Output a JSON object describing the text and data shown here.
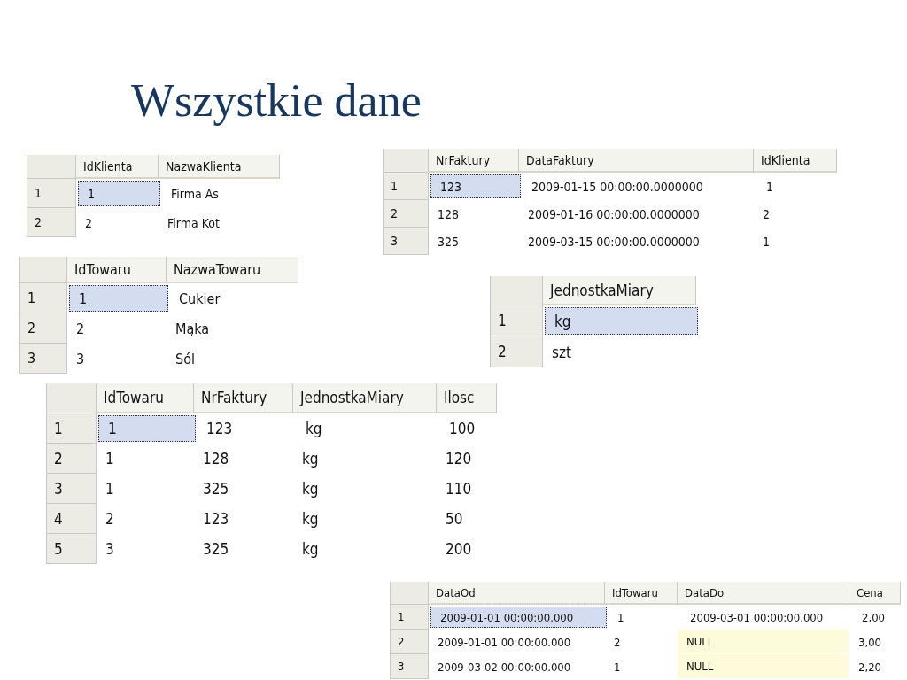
{
  "title": "Wszystkie dane",
  "tables": [
    {
      "columns": [
        "IdKlienta",
        "NazwaKlienta"
      ],
      "rows": [
        {
          "number": "1",
          "selected": true,
          "cells": [
            "1",
            "Firma As"
          ]
        },
        {
          "number": "2",
          "selected": false,
          "cells": [
            "2",
            "Firma Kot"
          ]
        }
      ]
    },
    {
      "columns": [
        "NrFaktury",
        "DataFaktury",
        "IdKlienta"
      ],
      "rows": [
        {
          "number": "1",
          "selected": true,
          "cells": [
            "123",
            "2009-01-15 00:00:00.0000000",
            "1"
          ]
        },
        {
          "number": "2",
          "selected": false,
          "cells": [
            "128",
            "2009-01-16 00:00:00.0000000",
            "2"
          ]
        },
        {
          "number": "3",
          "selected": false,
          "cells": [
            "325",
            "2009-03-15 00:00:00.0000000",
            "1"
          ]
        }
      ]
    },
    {
      "columns": [
        "IdTowaru",
        "NazwaTowaru"
      ],
      "rows": [
        {
          "number": "1",
          "selected": true,
          "cells": [
            "1",
            "Cukier"
          ]
        },
        {
          "number": "2",
          "selected": false,
          "cells": [
            "2",
            "Mąka"
          ]
        },
        {
          "number": "3",
          "selected": false,
          "cells": [
            "3",
            "Sól"
          ]
        }
      ]
    },
    {
      "columns": [
        "JednostkaMiary"
      ],
      "rows": [
        {
          "number": "1",
          "selected": true,
          "cells": [
            "kg"
          ]
        },
        {
          "number": "2",
          "selected": false,
          "cells": [
            "szt"
          ]
        }
      ]
    },
    {
      "columns": [
        "IdTowaru",
        "NrFaktury",
        "JednostkaMiary",
        "Ilosc"
      ],
      "rows": [
        {
          "number": "1",
          "selected": true,
          "cells": [
            "1",
            "123",
            "kg",
            "100"
          ]
        },
        {
          "number": "2",
          "selected": false,
          "cells": [
            "1",
            "128",
            "kg",
            "120"
          ]
        },
        {
          "number": "3",
          "selected": false,
          "cells": [
            "1",
            "325",
            "kg",
            "110"
          ]
        },
        {
          "number": "4",
          "selected": false,
          "cells": [
            "2",
            "123",
            "kg",
            "50"
          ]
        },
        {
          "number": "5",
          "selected": false,
          "cells": [
            "3",
            "325",
            "kg",
            "200"
          ]
        }
      ]
    },
    {
      "columns": [
        "DataOd",
        "IdTowaru",
        "DataDo",
        "Cena"
      ],
      "rows": [
        {
          "number": "1",
          "selected": true,
          "cells": [
            "2009-01-01 00:00:00.000",
            "1",
            "2009-03-01 00:00:00.000",
            "2,00"
          ]
        },
        {
          "number": "2",
          "selected": false,
          "cells": [
            "2009-01-01 00:00:00.000",
            "2",
            {
              "text": "NULL",
              "kind": "null"
            },
            "3,00"
          ]
        },
        {
          "number": "3",
          "selected": false,
          "cells": [
            "2009-03-02 00:00:00.000",
            "1",
            {
              "text": "NULL",
              "kind": "null"
            },
            "2,20"
          ]
        }
      ]
    }
  ]
}
